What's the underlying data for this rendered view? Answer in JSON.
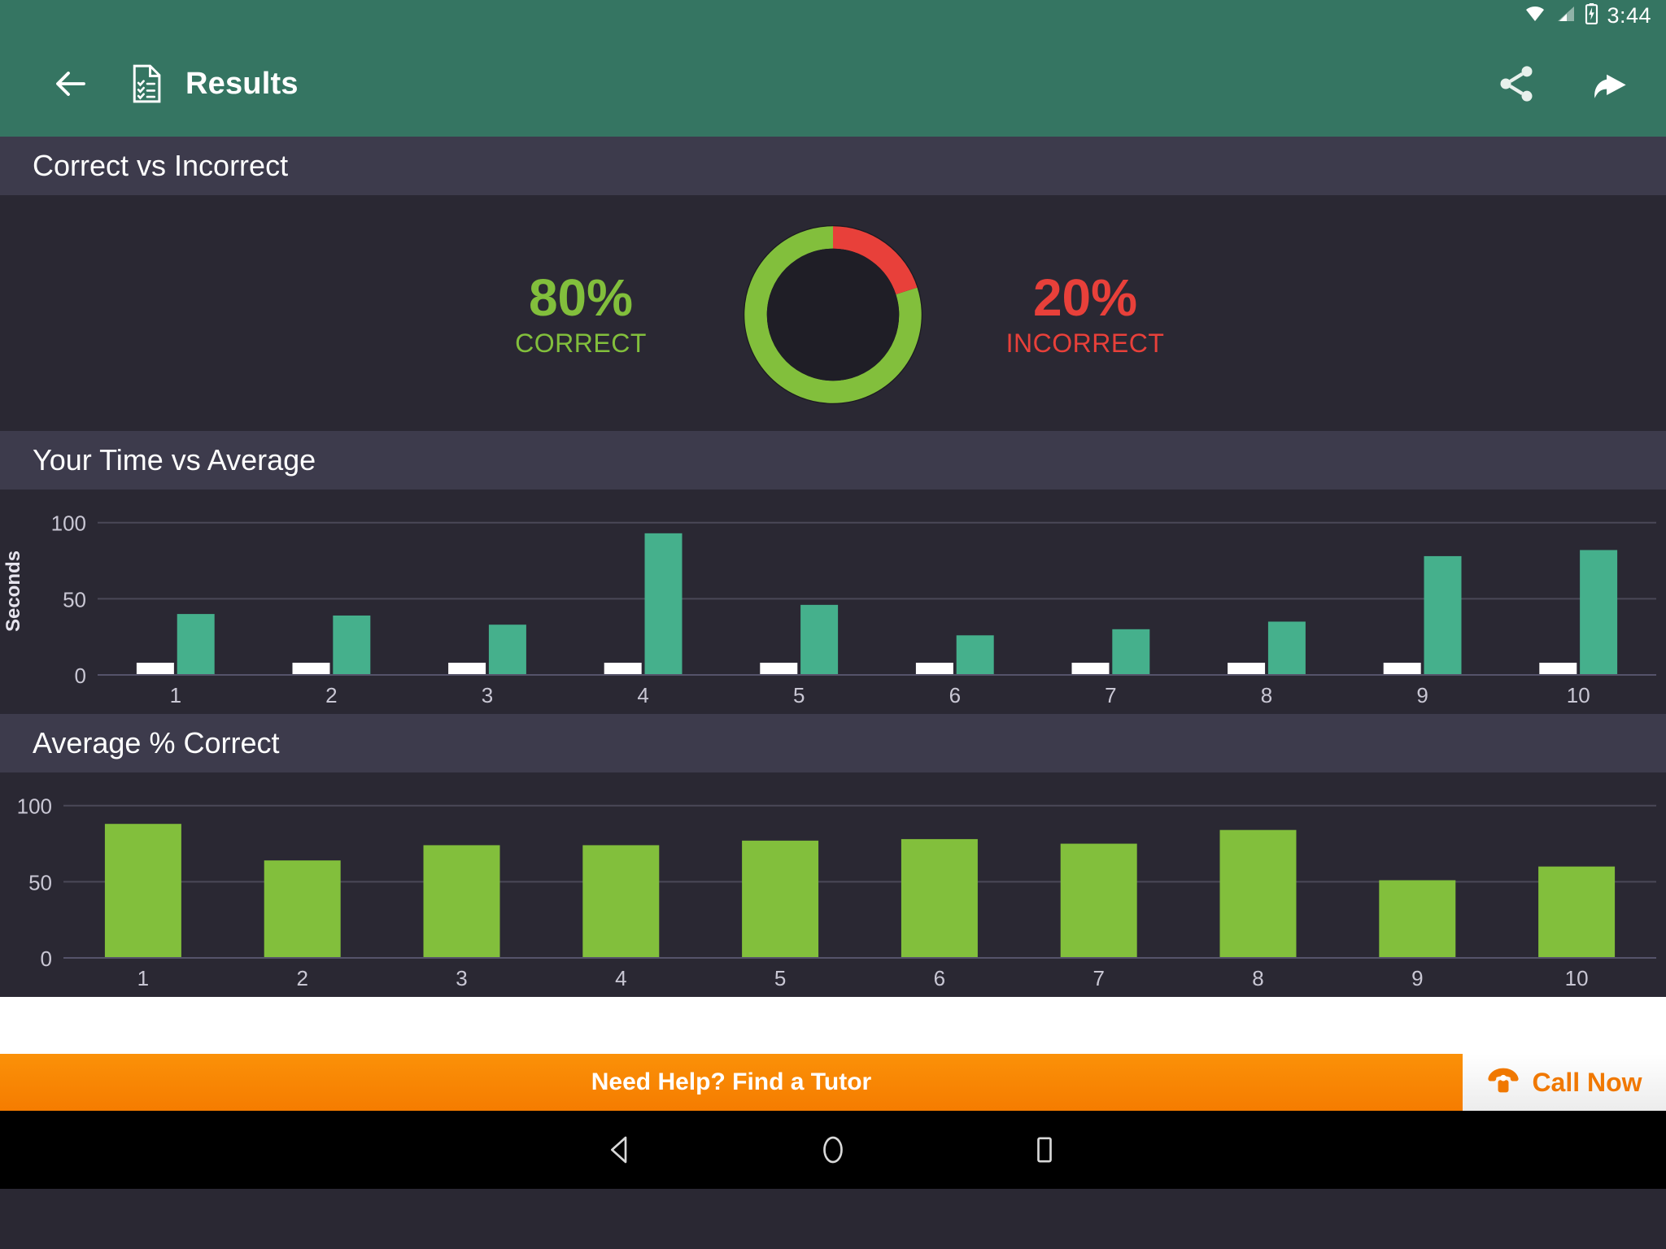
{
  "statusbar": {
    "time": "3:44",
    "icons": [
      "wifi-icon",
      "cellular-signal-icon",
      "battery-charging-icon"
    ]
  },
  "appbar": {
    "title": "Results",
    "back_icon": "back-arrow-icon",
    "doc_icon": "checklist-document-icon",
    "share_icon": "share-icon",
    "forward_icon": "redo-arrow-icon",
    "background": "#357562"
  },
  "sections": [
    {
      "title": "Correct vs Incorrect"
    },
    {
      "title": "Your Time vs Average"
    },
    {
      "title": "Average % Correct"
    }
  ],
  "donut": {
    "correct_value": "80%",
    "correct_label": "CORRECT",
    "incorrect_value": "20%",
    "incorrect_label": "INCORRECT",
    "correct_color": "#82BF3C",
    "incorrect_color": "#E8403A",
    "hole_color": "#1F1E26"
  },
  "banner": {
    "text": "Need Help? Find a Tutor",
    "call_label": "Call Now",
    "phone_icon": "telephone-icon",
    "accent": "#F57C00"
  },
  "navbar": {
    "back": "nav-back-triangle-icon",
    "home": "nav-home-circle-icon",
    "recents": "nav-recents-square-icon"
  },
  "chart_data": [
    {
      "type": "bar",
      "title": "Your Time vs Average",
      "xlabel": "",
      "ylabel": "Seconds",
      "categories": [
        "1",
        "2",
        "3",
        "4",
        "5",
        "6",
        "7",
        "8",
        "9",
        "10"
      ],
      "ylim": [
        0,
        110
      ],
      "yticks": [
        0,
        50,
        100
      ],
      "ytick_labels": [
        "0",
        "50",
        "100"
      ],
      "grid": true,
      "legend": "none",
      "series": [
        {
          "name": "Your Time",
          "color": "#FFFFFF",
          "values": [
            8,
            8,
            8,
            8,
            8,
            8,
            8,
            8,
            8,
            8
          ]
        },
        {
          "name": "Average",
          "color": "#45B08C",
          "values": [
            40,
            39,
            33,
            93,
            46,
            26,
            30,
            35,
            78,
            82
          ]
        }
      ]
    },
    {
      "type": "bar",
      "title": "Average % Correct",
      "xlabel": "",
      "ylabel": "",
      "categories": [
        "1",
        "2",
        "3",
        "4",
        "5",
        "6",
        "7",
        "8",
        "9",
        "10"
      ],
      "ylim": [
        0,
        110
      ],
      "yticks": [
        0,
        50,
        100
      ],
      "ytick_labels": [
        "0",
        "50",
        "100"
      ],
      "grid": true,
      "legend": "none",
      "series": [
        {
          "name": "Average % Correct",
          "color": "#82BF3C",
          "values": [
            88,
            64,
            74,
            74,
            77,
            78,
            75,
            84,
            51,
            60
          ]
        }
      ]
    }
  ]
}
